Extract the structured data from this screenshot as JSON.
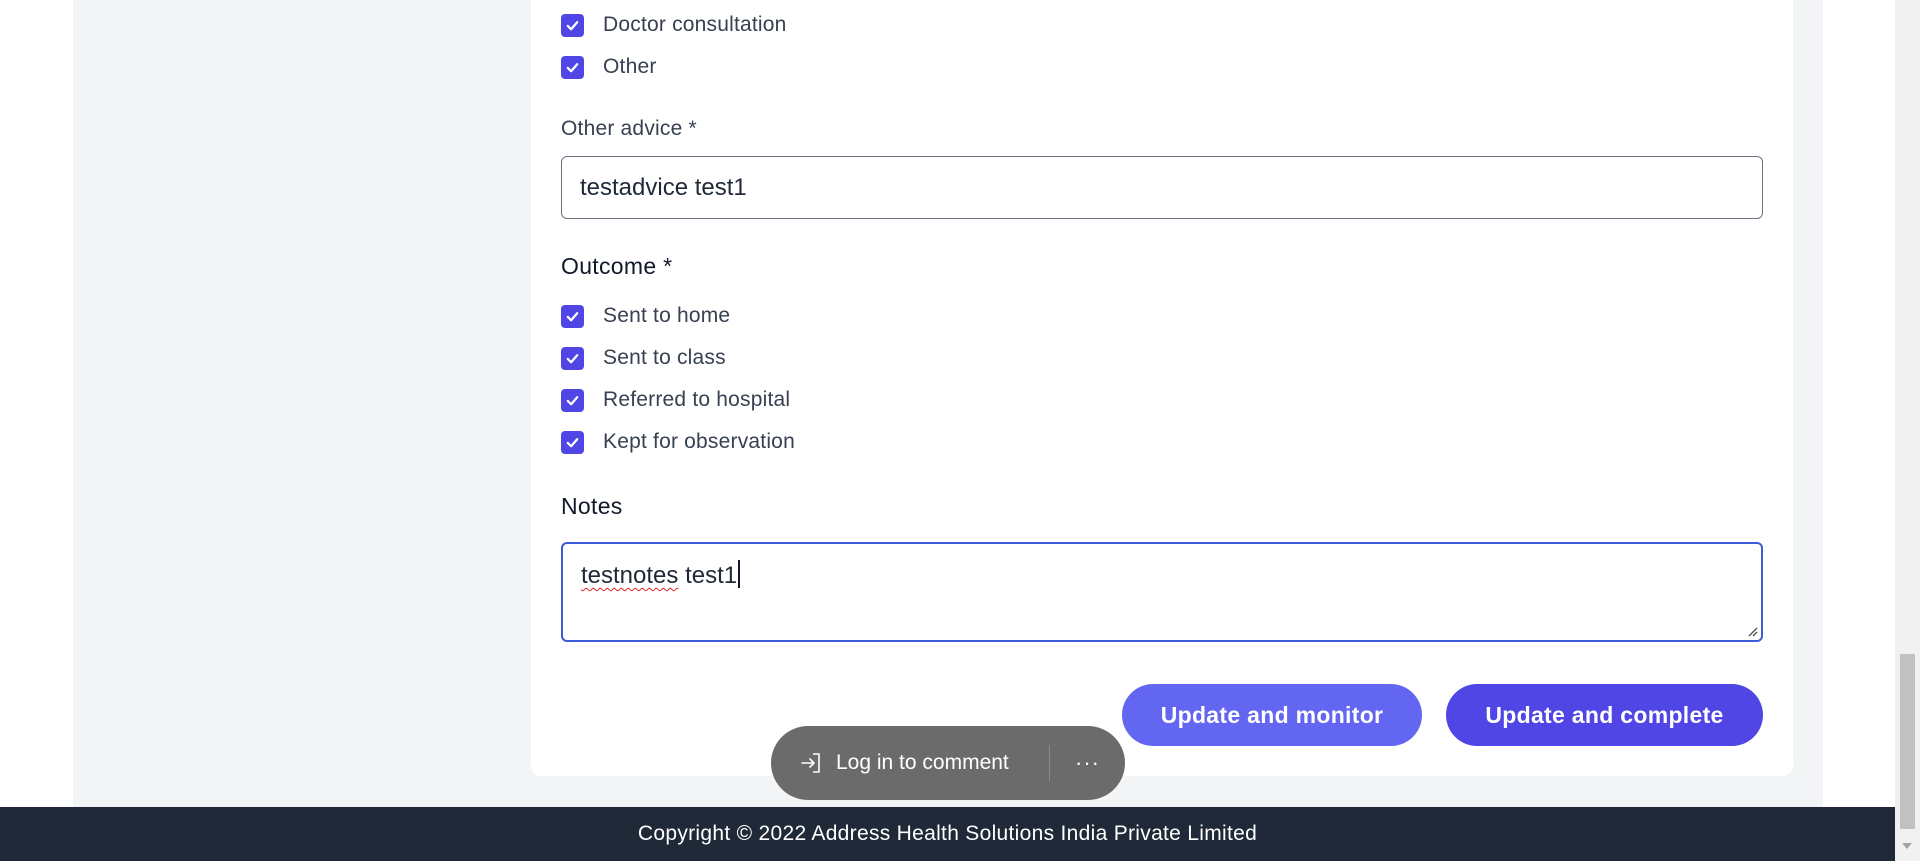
{
  "advice_options": [
    {
      "label": "Doctor consultation",
      "checked": true
    },
    {
      "label": "Other",
      "checked": true
    }
  ],
  "other_advice": {
    "label": "Other advice *",
    "value": "testadvice test1"
  },
  "outcome": {
    "title": "Outcome *",
    "options": [
      {
        "label": "Sent to home",
        "checked": true
      },
      {
        "label": "Sent to class",
        "checked": true
      },
      {
        "label": "Referred to hospital",
        "checked": true
      },
      {
        "label": "Kept for observation",
        "checked": true
      }
    ]
  },
  "notes": {
    "title": "Notes",
    "value_misspelled": "testnotes",
    "value_rest": " test1"
  },
  "buttons": {
    "update_monitor": "Update and monitor",
    "update_complete": "Update and complete"
  },
  "comment_pill": {
    "login_label": "Log in to comment",
    "more_label": "···",
    "login_icon": "sign-in-icon"
  },
  "footer": {
    "copyright": "Copyright © 2022 Address Health Solutions India Private Limited"
  },
  "colors": {
    "accent": "#4f46e5",
    "accent_light": "#6366f1",
    "footer_bg": "#1f2937",
    "focus_border": "#3b5bdb"
  }
}
